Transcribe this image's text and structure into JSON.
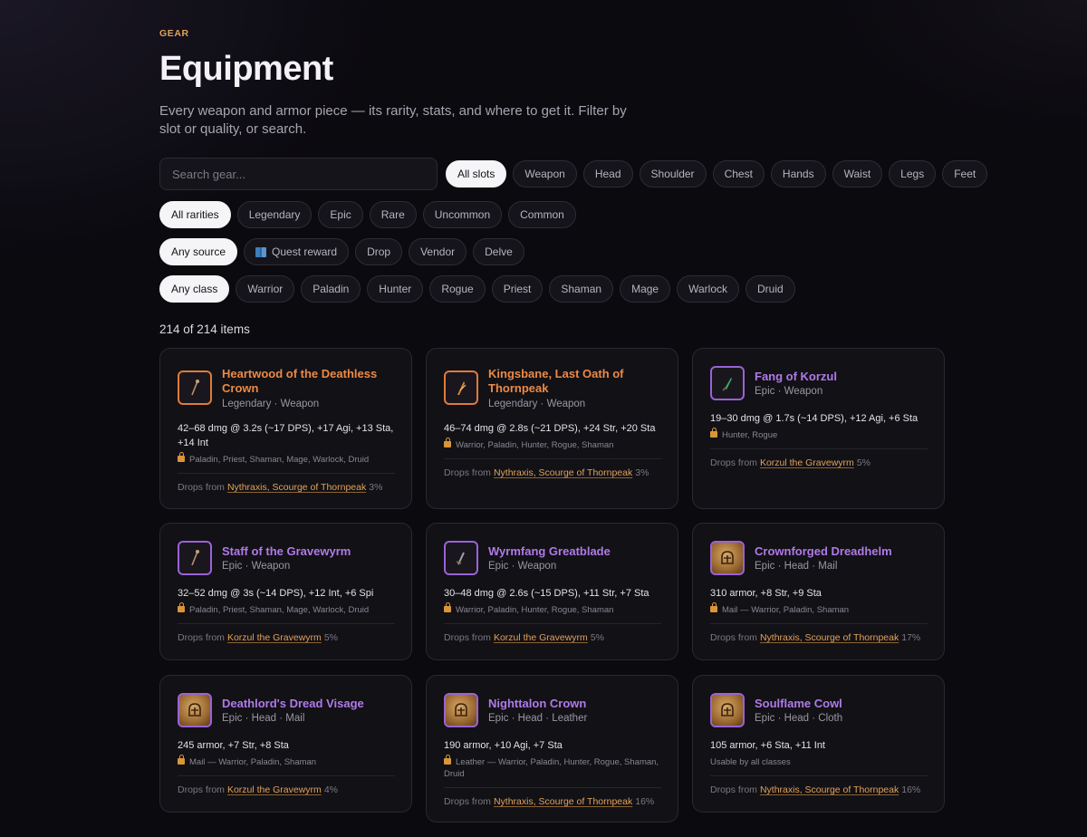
{
  "header": {
    "eyebrow": "GEAR",
    "title": "Equipment",
    "subtitle": "Every weapon and armor piece — its rarity, stats, and where to get it. Filter by slot or quality, or search."
  },
  "search": {
    "placeholder": "Search gear...",
    "value": ""
  },
  "filters": {
    "slots": [
      "All slots",
      "Weapon",
      "Head",
      "Shoulder",
      "Chest",
      "Hands",
      "Waist",
      "Legs",
      "Feet"
    ],
    "rarities": [
      "All rarities",
      "Legendary",
      "Epic",
      "Rare",
      "Uncommon",
      "Common"
    ],
    "sources": [
      "Any source",
      "Quest reward",
      "Drop",
      "Vendor",
      "Delve"
    ],
    "classes": [
      "Any class",
      "Warrior",
      "Paladin",
      "Hunter",
      "Rogue",
      "Priest",
      "Shaman",
      "Mage",
      "Warlock",
      "Druid"
    ],
    "source_icons": {
      "Quest reward": "book-icon"
    }
  },
  "results": {
    "count_label": "214 of 214 items"
  },
  "items": [
    {
      "name": "Heartwood of the Deathless Crown",
      "rarity": "legendary",
      "meta": "Legendary · Weapon",
      "icon": "staff-icon",
      "stats": "42–68 dmg @ 3.2s (~17 DPS), +17 Agi, +13 Sta, +14 Int",
      "classes": "Paladin, Priest, Shaman, Mage, Warlock, Druid",
      "source_prefix": "Drops from",
      "source_name": "Nythraxis, Scourge of Thornpeak",
      "chance": "3%"
    },
    {
      "name": "Kingsbane, Last Oath of Thornpeak",
      "rarity": "legendary",
      "meta": "Legendary · Weapon",
      "icon": "flame-blade-icon",
      "stats": "46–74 dmg @ 2.8s (~21 DPS), +24 Str, +20 Sta",
      "classes": "Warrior, Paladin, Hunter, Rogue, Shaman",
      "source_prefix": "Drops from",
      "source_name": "Nythraxis, Scourge of Thornpeak",
      "chance": "3%"
    },
    {
      "name": "Fang of Korzul",
      "rarity": "epic",
      "meta": "Epic · Weapon",
      "icon": "dagger-icon",
      "stats": "19–30 dmg @ 1.7s (~14 DPS), +12 Agi, +6 Sta",
      "classes": "Hunter, Rogue",
      "source_prefix": "Drops from",
      "source_name": "Korzul the Gravewyrm",
      "chance": "5%"
    },
    {
      "name": "Staff of the Gravewyrm",
      "rarity": "epic",
      "meta": "Epic · Weapon",
      "icon": "staff-icon",
      "stats": "32–52 dmg @ 3s (~14 DPS), +12 Int, +6 Spi",
      "classes": "Paladin, Priest, Shaman, Mage, Warlock, Druid",
      "source_prefix": "Drops from",
      "source_name": "Korzul the Gravewyrm",
      "chance": "5%"
    },
    {
      "name": "Wyrmfang Greatblade",
      "rarity": "epic",
      "meta": "Epic · Weapon",
      "icon": "sword-icon",
      "stats": "30–48 dmg @ 2.6s (~15 DPS), +11 Str, +7 Sta",
      "classes": "Warrior, Paladin, Hunter, Rogue, Shaman",
      "source_prefix": "Drops from",
      "source_name": "Korzul the Gravewyrm",
      "chance": "5%"
    },
    {
      "name": "Crownforged Dreadhelm",
      "rarity": "epic",
      "meta": "Epic · Head · Mail",
      "icon": "helm-icon",
      "stats": "310 armor, +8 Str, +9 Sta",
      "classes": "Mail — Warrior, Paladin, Shaman",
      "source_prefix": "Drops from",
      "source_name": "Nythraxis, Scourge of Thornpeak",
      "chance": "17%"
    },
    {
      "name": "Deathlord's Dread Visage",
      "rarity": "epic",
      "meta": "Epic · Head · Mail",
      "icon": "helm-icon",
      "stats": "245 armor, +7 Str, +8 Sta",
      "classes": "Mail — Warrior, Paladin, Shaman",
      "source_prefix": "Drops from",
      "source_name": "Korzul the Gravewyrm",
      "chance": "4%"
    },
    {
      "name": "Nighttalon Crown",
      "rarity": "epic",
      "meta": "Epic · Head · Leather",
      "icon": "helm-icon",
      "stats": "190 armor, +10 Agi, +7 Sta",
      "classes": "Leather — Warrior, Paladin, Hunter, Rogue, Shaman, Druid",
      "source_prefix": "Drops from",
      "source_name": "Nythraxis, Scourge of Thornpeak",
      "chance": "16%"
    },
    {
      "name": "Soulflame Cowl",
      "rarity": "epic",
      "meta": "Epic · Head · Cloth",
      "icon": "helm-icon",
      "stats": "105 armor, +6 Sta, +11 Int",
      "classes": "Usable by all classes",
      "classes_unrestricted": true,
      "source_prefix": "Drops from",
      "source_name": "Nythraxis, Scourge of Thornpeak",
      "chance": "16%"
    }
  ]
}
